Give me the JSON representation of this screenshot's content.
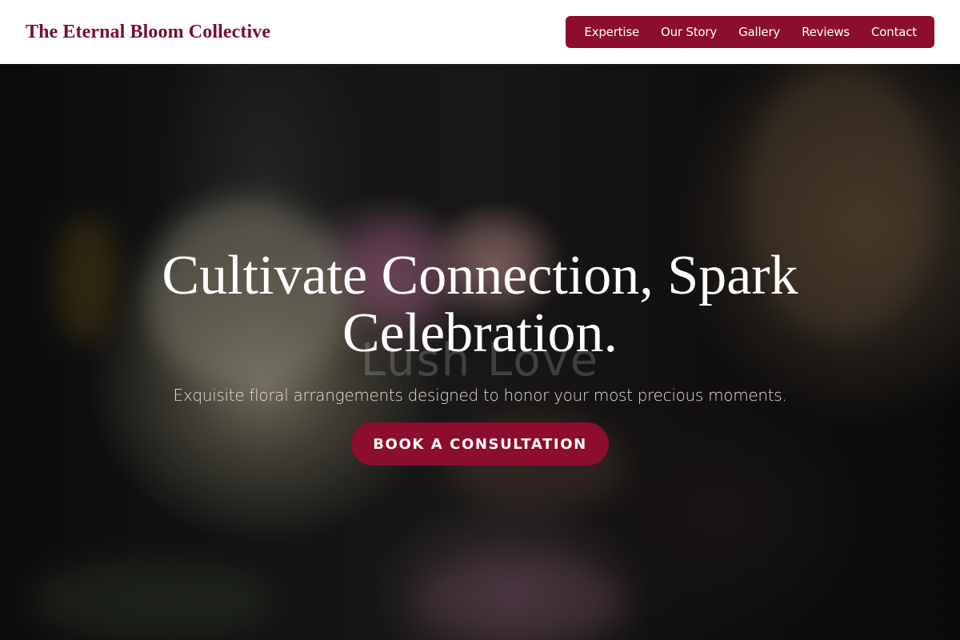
{
  "header": {
    "brand": "The Eternal Bloom Collective",
    "nav": [
      {
        "label": "Expertise"
      },
      {
        "label": "Our Story"
      },
      {
        "label": "Gallery"
      },
      {
        "label": "Reviews"
      },
      {
        "label": "Contact"
      }
    ]
  },
  "hero": {
    "title": "Cultivate Connection, Spark Celebration.",
    "ghost_text": "Lush Love",
    "subtitle": "Exquisite floral arrangements designed to honor your most precious moments.",
    "cta_label": "BOOK A CONSULTATION"
  },
  "colors": {
    "brand": "#7a0f2e",
    "accent": "#8c0d2e",
    "header_bg": "#ffffff"
  }
}
